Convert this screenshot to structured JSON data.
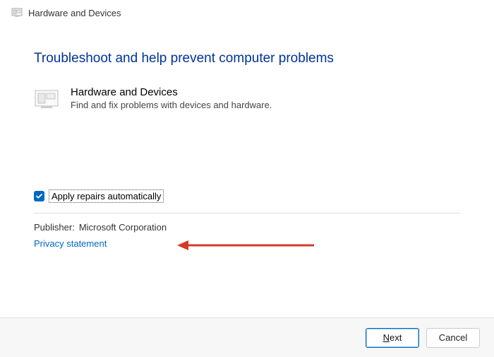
{
  "titlebar": {
    "title": "Hardware and Devices"
  },
  "heading": "Troubleshoot and help prevent computer problems",
  "troubleshooter": {
    "title": "Hardware and Devices",
    "desc": "Find and fix problems with devices and hardware."
  },
  "checkbox": {
    "label": "Apply repairs automatically",
    "checked": true
  },
  "publisher": {
    "label": "Publisher:",
    "value": "Microsoft Corporation"
  },
  "privacy_link": "Privacy statement",
  "buttons": {
    "next_prefix": "N",
    "next_rest": "ext",
    "cancel": "Cancel"
  },
  "colors": {
    "accent": "#0067c0",
    "heading": "#003399",
    "arrow": "#d43a2a"
  }
}
